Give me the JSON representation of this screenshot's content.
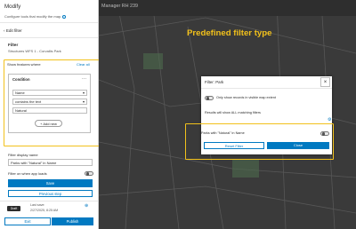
{
  "panel": {
    "title": "Modify",
    "subtitle": "Configure tools that modify the map.",
    "back_label": "Edit filter",
    "filter_label": "Filter",
    "filter_value": "Structures WFS 1 - Corvallis Park",
    "show_features_where": "Show features where",
    "clear_all": "Clear all",
    "condition": {
      "title": "Condition",
      "field": "Name",
      "operator": "contains the text",
      "value": "Natural",
      "add_new": "Add new"
    },
    "display_name_label": "Filter display name",
    "display_name_value": "Parks with \"Natural\" in Name",
    "filter_on_load_label": "Filter on when app loads",
    "save_label": "Save",
    "previous_step_label": "Previous step",
    "draft_label": "Draft",
    "last_save_label": "Last save:",
    "last_save_value": "2/27/2025, 8:25 AM",
    "exit_label": "Exit",
    "publish_label": "Publish"
  },
  "map": {
    "header_title": "Manager RH 239",
    "annotation": "Predefined filter type"
  },
  "dialog": {
    "title": "Filter: Park",
    "only_visible_label": "Only show records in visible map extent",
    "results_label": "Results will show ALL matching filters",
    "park_filter_label": "Parks with \"Natural\" in Name",
    "reset_label": "Reset Filter",
    "close_label": "Close"
  },
  "colors": {
    "accent": "#0079c1",
    "highlight": "#f2c11b",
    "map_background": "#3c3c3c"
  },
  "icons": [
    "info-icon",
    "chevron-left-icon",
    "more-icon",
    "plus-icon",
    "close-icon",
    "gear-icon",
    "share-icon"
  ]
}
